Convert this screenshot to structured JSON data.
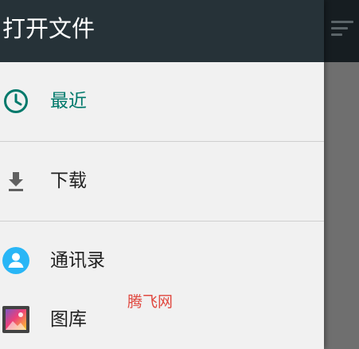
{
  "header": {
    "title": "打开文件"
  },
  "nav": {
    "items": [
      {
        "label": "最近",
        "icon": "clock-icon",
        "active": true
      },
      {
        "label": "下载",
        "icon": "download-icon",
        "active": false
      },
      {
        "label": "通讯录",
        "icon": "contact-icon",
        "active": false
      },
      {
        "label": "图库",
        "icon": "gallery-icon",
        "active": false
      }
    ]
  },
  "watermark": {
    "text": "腾飞网"
  },
  "colors": {
    "header_bg": "#263238",
    "accent": "#00796b",
    "contact_blue": "#29b6f6",
    "drawer_bg": "#f1f1f1",
    "watermark_red": "#e0483f"
  }
}
